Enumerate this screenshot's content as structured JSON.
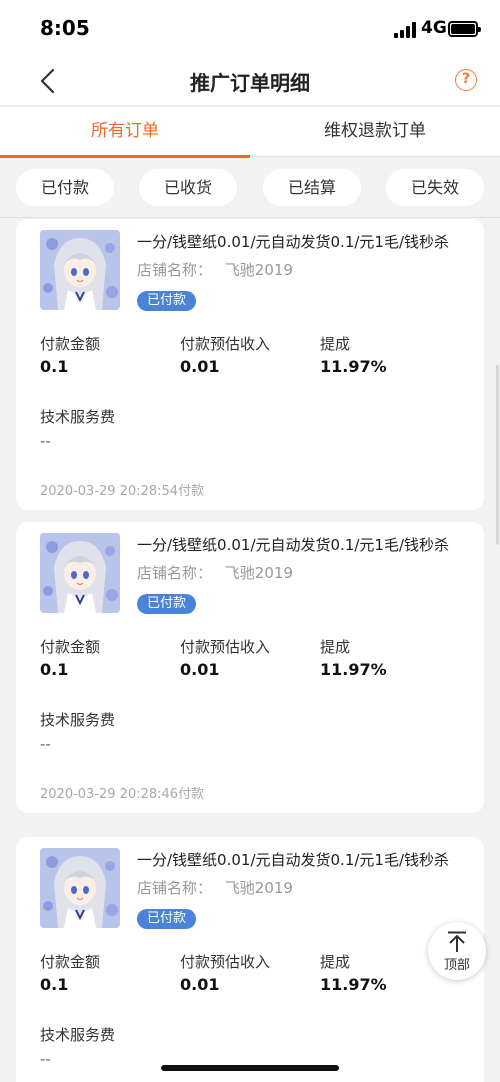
{
  "status_bar": {
    "time": "8:05",
    "network": "4G"
  },
  "nav": {
    "title": "推广订单明细",
    "help_glyph": "?"
  },
  "tabs": [
    {
      "label": "所有订单",
      "active": true
    },
    {
      "label": "维权退款订单",
      "active": false
    }
  ],
  "filters": [
    "已付款",
    "已收货",
    "已结算",
    "已失效"
  ],
  "orders": [
    {
      "title": "一分/钱壁纸0.01/元自动发货0.1/元1毛/钱秒杀",
      "shop_label": "店铺名称：",
      "shop_name": "飞驰2019",
      "status": "已付款",
      "metrics": [
        {
          "label": "付款金额",
          "value": "0.1"
        },
        {
          "label": "付款预估收入",
          "value": "0.01"
        },
        {
          "label": "提成",
          "value": "11.97%"
        }
      ],
      "fee_label": "技术服务费",
      "fee_value": "--",
      "time": "2020-03-29 20:28:54付款"
    },
    {
      "title": "一分/钱壁纸0.01/元自动发货0.1/元1毛/钱秒杀",
      "shop_label": "店铺名称：",
      "shop_name": "飞驰2019",
      "status": "已付款",
      "metrics": [
        {
          "label": "付款金额",
          "value": "0.1"
        },
        {
          "label": "付款预估收入",
          "value": "0.01"
        },
        {
          "label": "提成",
          "value": "11.97%"
        }
      ],
      "fee_label": "技术服务费",
      "fee_value": "--",
      "time": "2020-03-29 20:28:46付款"
    },
    {
      "title": "一分/钱壁纸0.01/元自动发货0.1/元1毛/钱秒杀",
      "shop_label": "店铺名称：",
      "shop_name": "飞驰2019",
      "status": "已付款",
      "metrics": [
        {
          "label": "付款金额",
          "value": "0.1"
        },
        {
          "label": "付款预估收入",
          "value": "0.01"
        },
        {
          "label": "提成",
          "value": "11.97%"
        }
      ],
      "fee_label": "技术服务费",
      "fee_value": "--",
      "time": ""
    }
  ],
  "back_to_top": {
    "label": "顶部"
  },
  "colors": {
    "accent": "#ee6a25",
    "badge": "#4a83d8",
    "background": "#f2f2f2"
  },
  "icons": {
    "back": "chevron-left-icon",
    "help": "question-circle-icon",
    "top": "arrow-up-icon",
    "signal": "cellular-signal-icon",
    "battery": "battery-icon"
  }
}
